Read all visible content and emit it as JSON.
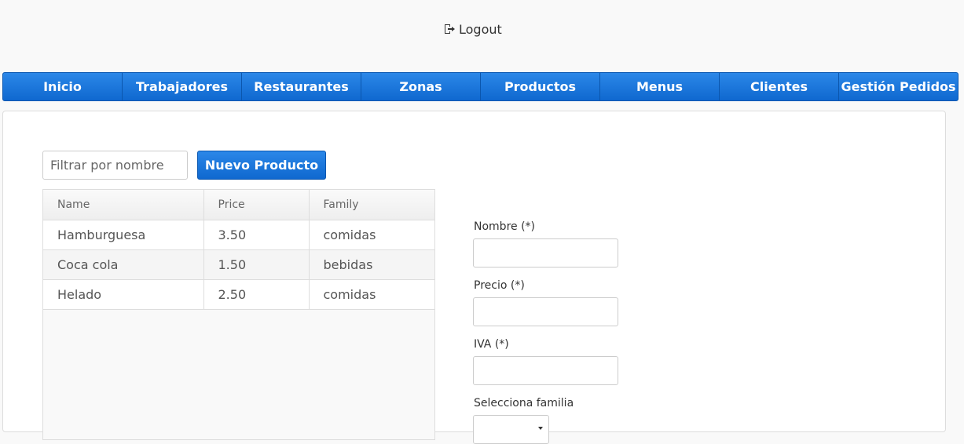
{
  "header": {
    "logout_label": "Logout",
    "logout_icon": "logout-icon"
  },
  "nav": {
    "items": [
      {
        "label": "Inicio"
      },
      {
        "label": "Trabajadores"
      },
      {
        "label": "Restaurantes"
      },
      {
        "label": "Zonas"
      },
      {
        "label": "Productos"
      },
      {
        "label": "Menus"
      },
      {
        "label": "Clientes"
      },
      {
        "label": "Gestión Pedidos"
      }
    ]
  },
  "toolbar": {
    "filter_placeholder": "Filtrar por nombre",
    "filter_value": "",
    "new_button_label": "Nuevo Producto"
  },
  "table": {
    "columns": [
      "Name",
      "Price",
      "Family"
    ],
    "rows": [
      [
        "Hamburguesa",
        "3.50",
        "comidas"
      ],
      [
        "Coca cola",
        "1.50",
        "bebidas"
      ],
      [
        "Helado",
        "2.50",
        "comidas"
      ]
    ]
  },
  "form": {
    "nombre_label": "Nombre (*)",
    "nombre_value": "",
    "precio_label": "Precio (*)",
    "precio_value": "",
    "iva_label": "IVA (*)",
    "iva_value": "",
    "familia_label": "Selecciona familia"
  },
  "colors": {
    "accent": "#1a73d9",
    "accent_border": "#0a57b0"
  }
}
